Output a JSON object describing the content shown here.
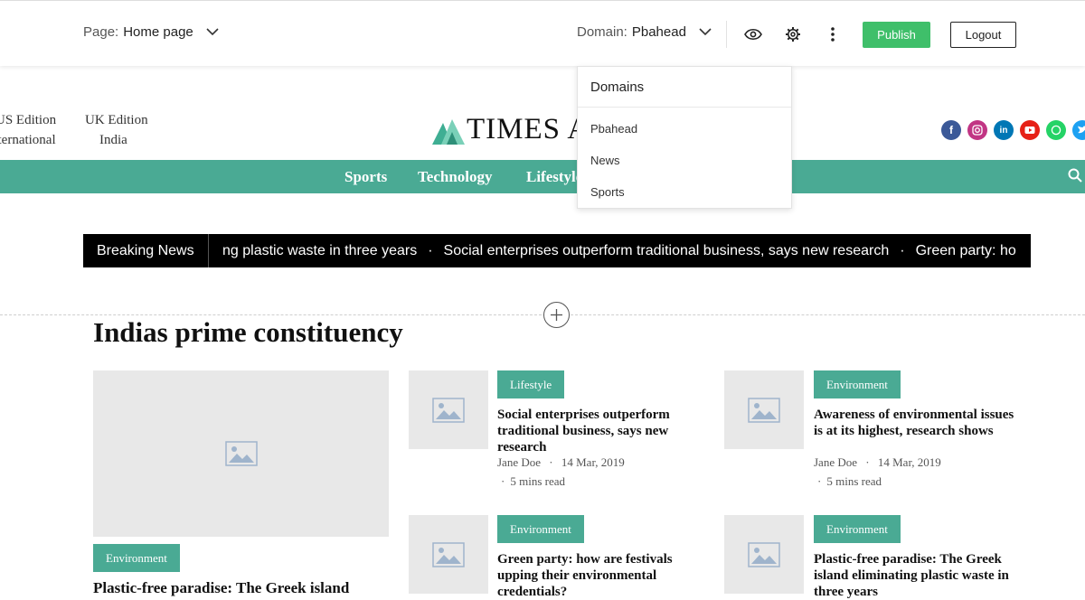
{
  "topbar": {
    "page_label": "Page:",
    "page_value": "Home page",
    "domain_label": "Domain:",
    "domain_value": "Pbahead",
    "publish_label": "Publish",
    "logout_label": "Logout"
  },
  "domains_dropdown": {
    "header": "Domains",
    "items": [
      "Pbahead",
      "News",
      "Sports"
    ]
  },
  "editions": [
    "US Edition",
    "UK Edition",
    "International",
    "India"
  ],
  "logo": {
    "text": "TIMES A"
  },
  "socials": [
    "facebook-icon",
    "instagram-icon",
    "linkedin-icon",
    "youtube-icon",
    "whatsapp-icon",
    "twitter-icon"
  ],
  "colors": {
    "accent": "#4aaa94",
    "publish": "#3fbf6a",
    "facebook": "#3b5998",
    "instagram": "#c13584",
    "linkedin": "#0077b5",
    "youtube": "#e62117",
    "whatsapp": "#25d366",
    "twitter": "#1da1f2"
  },
  "nav": {
    "items": [
      "Sports",
      "Technology",
      "Lifestyle"
    ]
  },
  "breaking": {
    "label": "Breaking News",
    "items": [
      "ng plastic waste in three years",
      "Social enterprises outperform traditional business, says new research",
      "Green party: ho"
    ]
  },
  "section": {
    "title": "Indias prime constituency"
  },
  "featured": {
    "tag": "Environment",
    "headline": "Plastic-free paradise: The Greek island"
  },
  "articles": [
    {
      "tag": "Lifestyle",
      "headline": "Social enterprises outperform traditional business, says new research",
      "author": "Jane Doe",
      "date": "14 Mar, 2019",
      "read": "5 mins read"
    },
    {
      "tag": "Environment",
      "headline": "Awareness of environmental issues is at its highest, research shows",
      "author": "Jane Doe",
      "date": "14 Mar, 2019",
      "read": "5 mins read"
    },
    {
      "tag": "Environment",
      "headline": "Green party: how are festivals upping their environmental credentials?"
    },
    {
      "tag": "Environment",
      "headline": "Plastic-free paradise: The Greek island eliminating plastic waste in three years"
    }
  ]
}
